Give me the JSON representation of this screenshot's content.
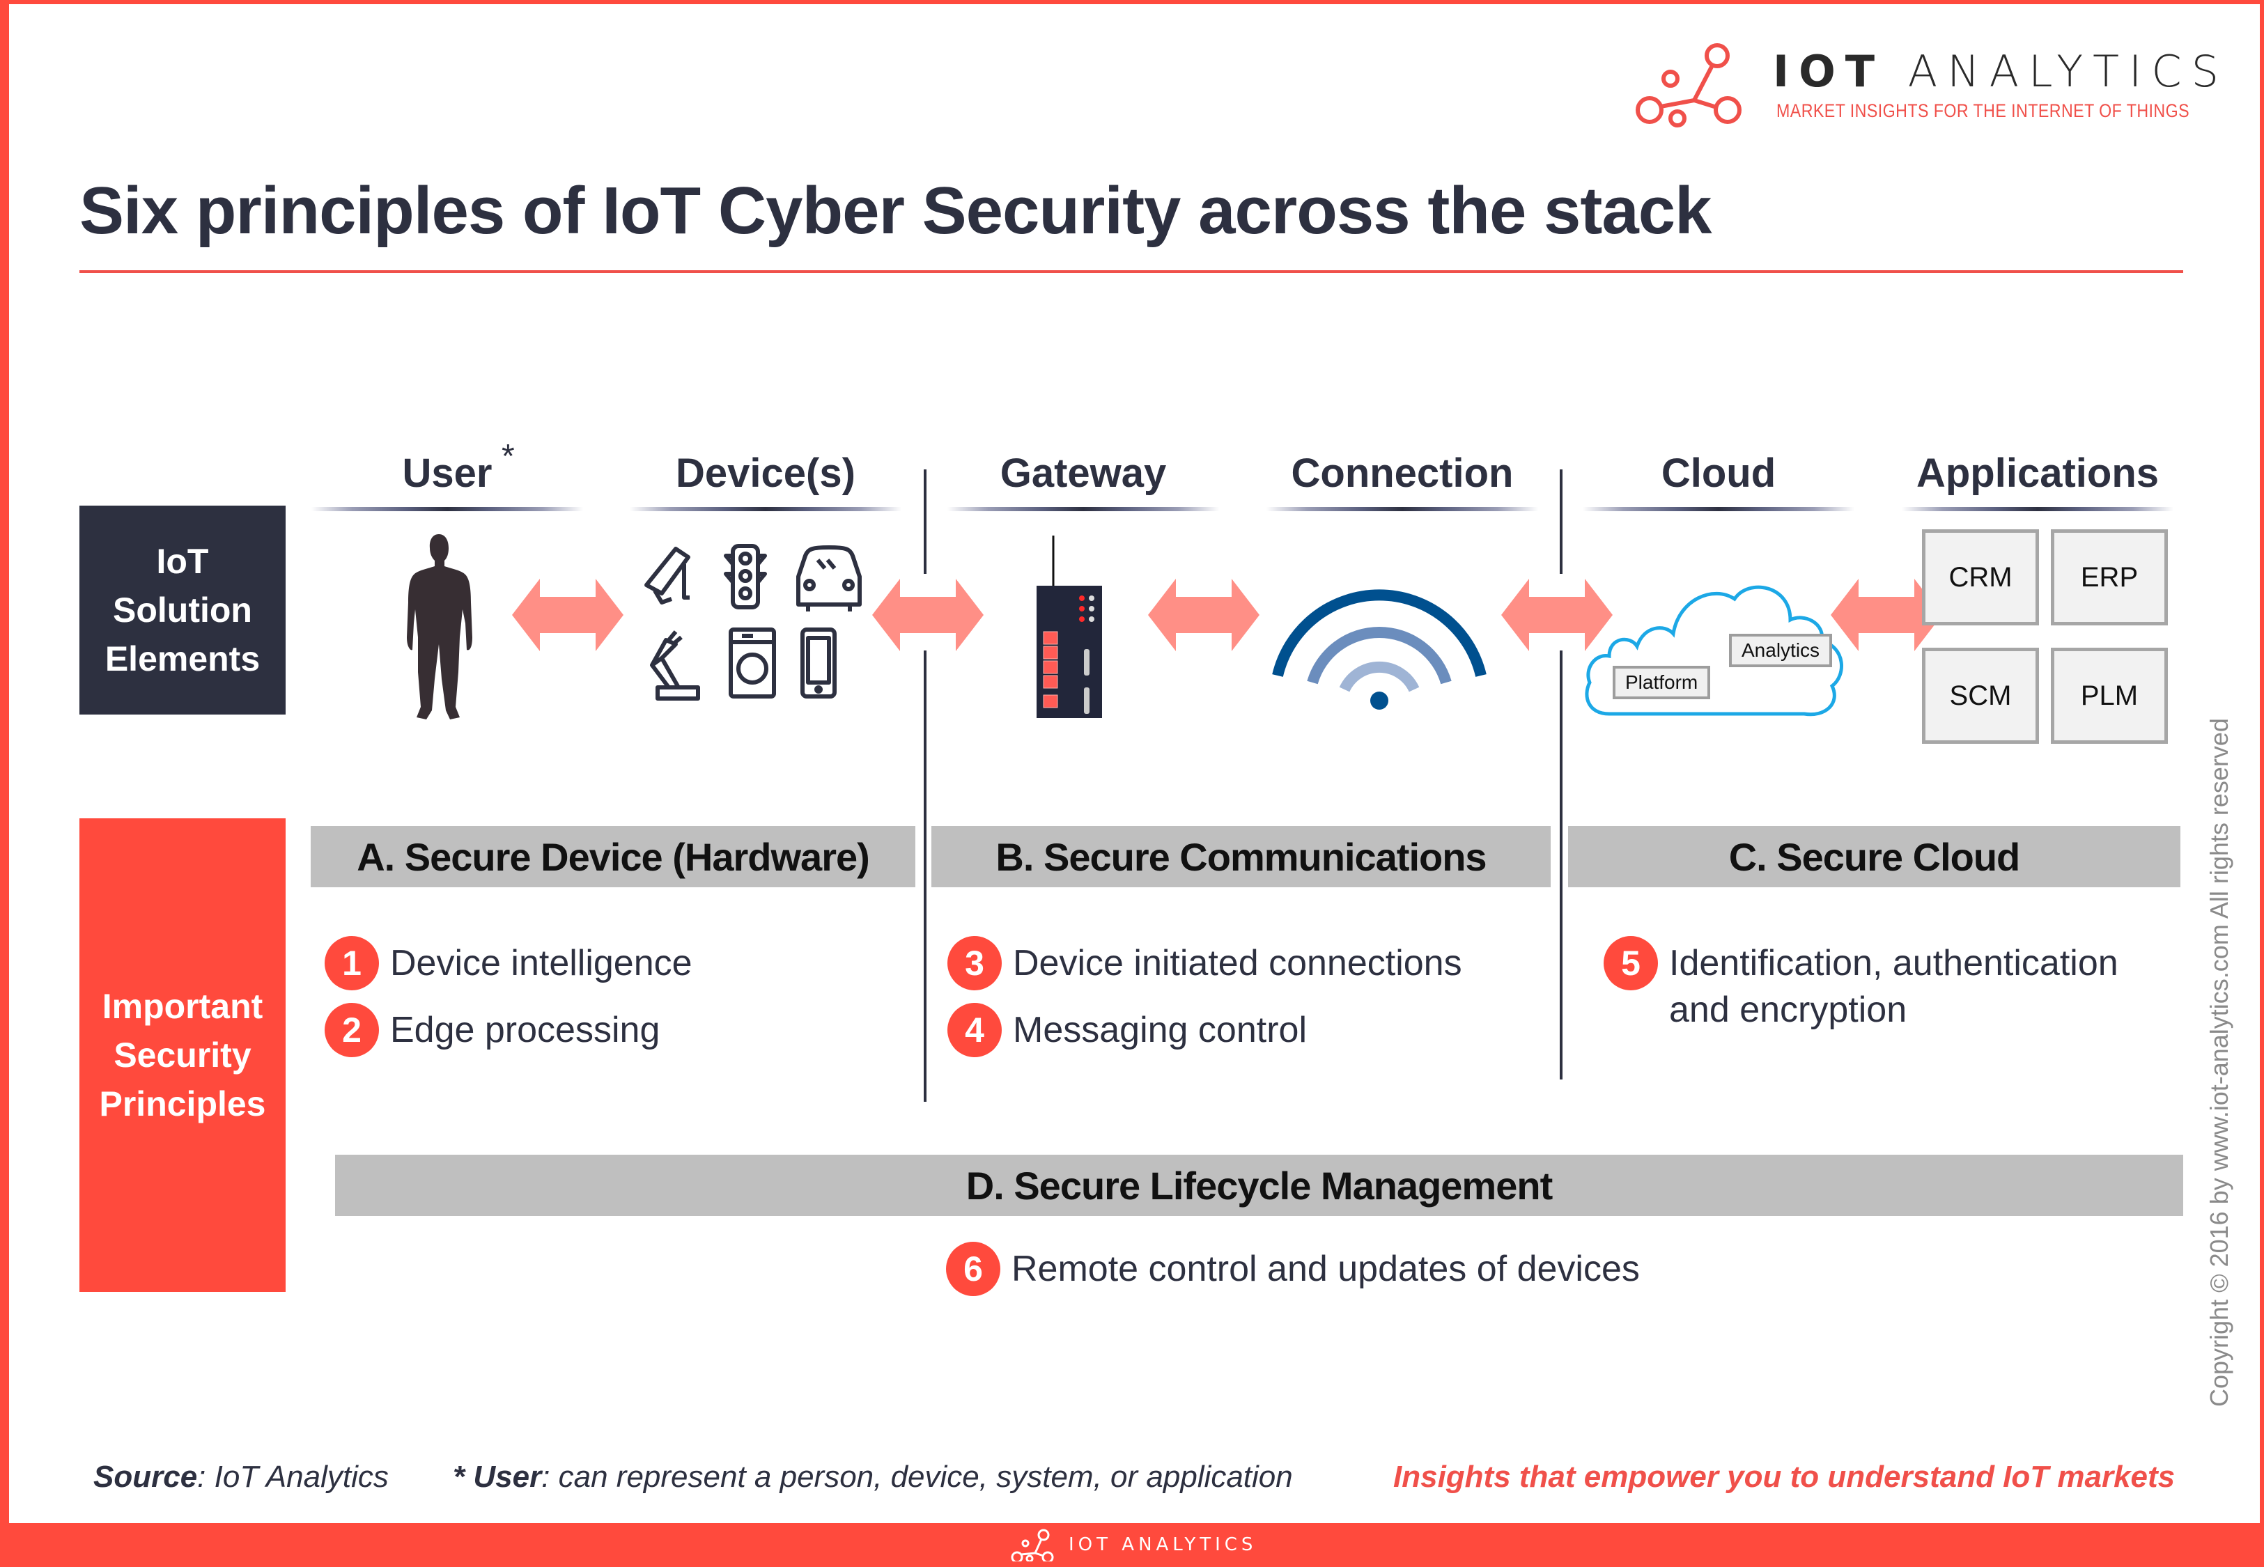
{
  "brand": {
    "name_bold": "IOT",
    "name_light": "ANALYTICS",
    "tagline": "MARKET INSIGHTS FOR THE INTERNET OF THINGS",
    "accent_color": "#ff4a3d",
    "dark_color": "#2d3040",
    "arrow_color": "#ff8f86",
    "wifi_color": "#00508f"
  },
  "title": "Six principles of IoT Cyber Security across the stack",
  "stack": {
    "columns": [
      {
        "label": "User",
        "icon": "person-silhouette-icon"
      },
      {
        "label": "Device(s)",
        "icon": "devices-grid-icon"
      },
      {
        "label": "Gateway",
        "icon": "gateway-router-icon"
      },
      {
        "label": "Connection",
        "icon": "wifi-icon"
      },
      {
        "label": "Cloud",
        "icon": "cloud-icon"
      },
      {
        "label": "Applications",
        "icon": "applications-grid-icon"
      }
    ],
    "user_asterisk": "*",
    "device_icons": [
      "security-camera-icon",
      "traffic-light-icon",
      "car-icon",
      "robot-arm-icon",
      "washing-machine-icon",
      "smartphone-icon"
    ],
    "cloud_labels": {
      "analytics": "Analytics",
      "platform": "Platform"
    },
    "apps": [
      "CRM",
      "ERP",
      "SCM",
      "PLM"
    ]
  },
  "row_labels": {
    "elements": [
      "IoT",
      "Solution",
      "Elements"
    ],
    "principles": [
      "Important",
      "Security",
      "Principles"
    ]
  },
  "sections": {
    "a": {
      "title": "A. Secure Device (Hardware)",
      "items": [
        {
          "num": "1",
          "text": "Device intelligence"
        },
        {
          "num": "2",
          "text": "Edge processing"
        }
      ]
    },
    "b": {
      "title": "B. Secure Communications",
      "items": [
        {
          "num": "3",
          "text": "Device initiated connections"
        },
        {
          "num": "4",
          "text": "Messaging control"
        }
      ]
    },
    "c": {
      "title": "C. Secure Cloud",
      "items": [
        {
          "num": "5",
          "text": "Identification, authentication",
          "text_line2": "and encryption"
        }
      ]
    },
    "d": {
      "title": "D. Secure Lifecycle Management",
      "items": [
        {
          "num": "6",
          "text": "Remote control and updates of devices"
        }
      ]
    }
  },
  "footer": {
    "source_label": "Source",
    "source_value": ": IoT Analytics",
    "note_label": "* User",
    "note_value": ": can represent a person, device, system, or application",
    "tagline": "Insights that empower you to understand IoT markets"
  },
  "copyright": "Copyright © 2016 by www.iot-analytics.com All rights reserved",
  "bottom_logo": {
    "text": "IOT ANALYTICS"
  }
}
